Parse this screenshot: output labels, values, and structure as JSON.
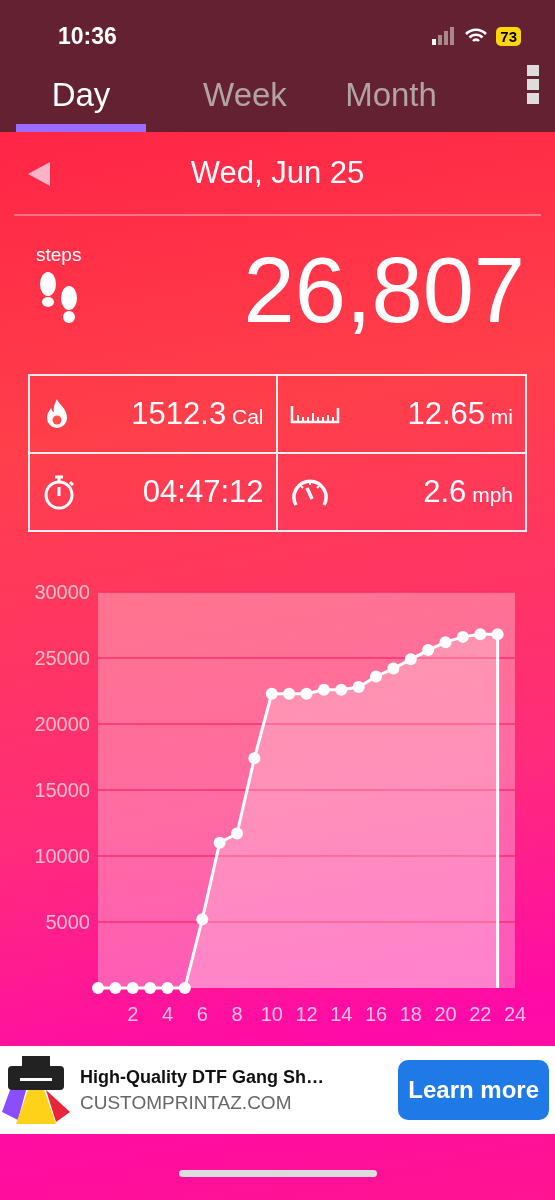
{
  "status_bar": {
    "time": "10:36",
    "battery": "73"
  },
  "tabs": [
    {
      "label": "Day",
      "selected": true
    },
    {
      "label": "Week",
      "selected": false
    },
    {
      "label": "Month",
      "selected": false
    }
  ],
  "date": "Wed, Jun 25",
  "steps": {
    "label": "steps",
    "value": "26,807"
  },
  "stats": [
    {
      "value": "1512.3",
      "unit": "Cal"
    },
    {
      "value": "12.65",
      "unit": "mi"
    },
    {
      "value": "04:47:12"
    },
    {
      "value": "2.6",
      "unit": "mph"
    }
  ],
  "chart": {
    "chart_data": {
      "type": "area",
      "x": [
        0,
        1,
        2,
        3,
        4,
        5,
        6,
        7,
        8,
        9,
        10,
        11,
        12,
        13,
        14,
        15,
        16,
        17,
        18,
        19,
        20,
        21,
        22,
        23
      ],
      "series": [
        {
          "color": "#ffffff",
          "values": [
            0,
            0,
            0,
            0,
            0,
            0,
            5200,
            11000,
            11700,
            17400,
            22300,
            22300,
            22300,
            22600,
            22600,
            22800,
            23600,
            24200,
            24900,
            25600,
            26200,
            26600,
            26800,
            26800
          ]
        }
      ],
      "grid": true,
      "xlim": [
        0,
        24
      ],
      "ylim": [
        0,
        30000
      ],
      "xticks": [
        2,
        4,
        6,
        8,
        10,
        12,
        14,
        16,
        18,
        20,
        22,
        24
      ],
      "yticks": [
        5000,
        10000,
        15000,
        20000,
        25000,
        30000
      ]
    }
  },
  "ad": {
    "title": "High-Quality DTF Gang Sh…",
    "domain": "CUSTOMPRINTAZ.COM",
    "button": "Learn more"
  }
}
